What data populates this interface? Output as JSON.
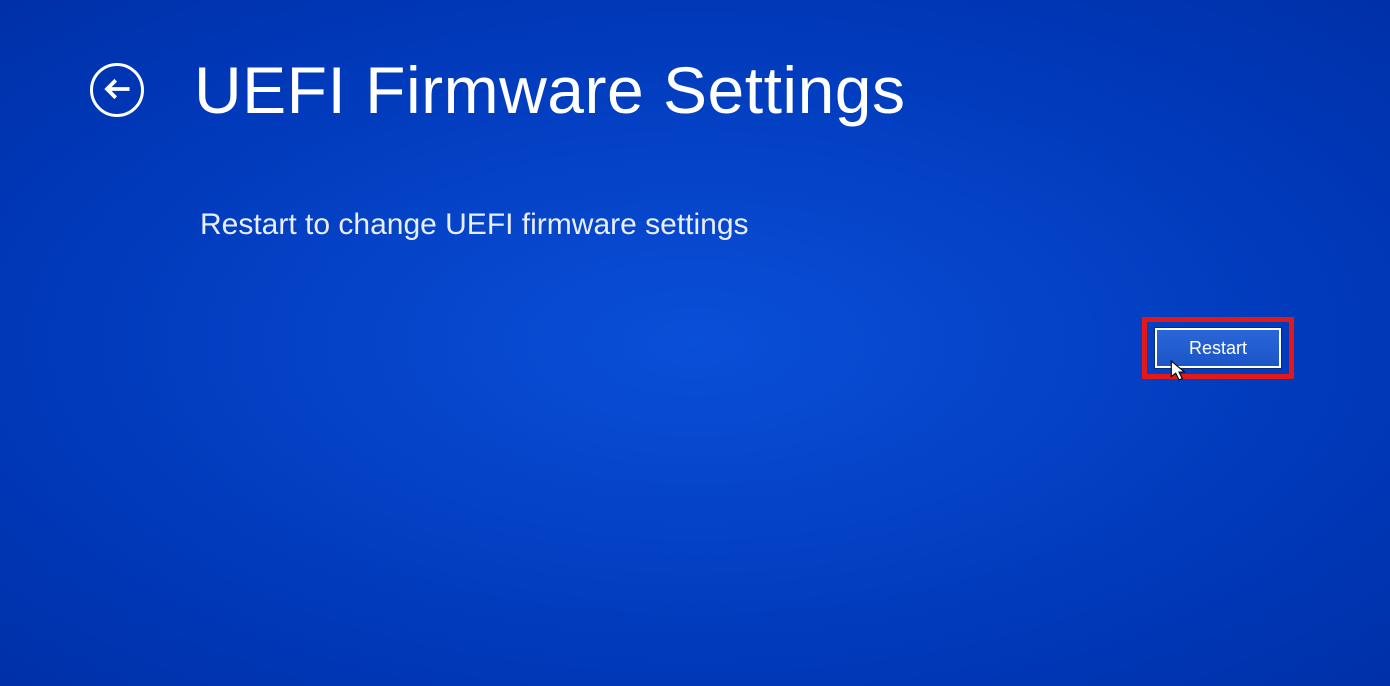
{
  "header": {
    "title": "UEFI Firmware Settings"
  },
  "main": {
    "subtitle": "Restart to change UEFI firmware settings"
  },
  "actions": {
    "restart_label": "Restart"
  }
}
